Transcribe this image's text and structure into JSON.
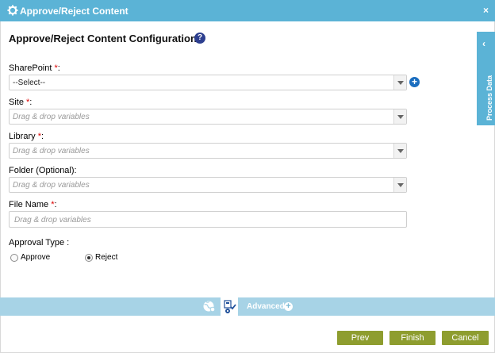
{
  "window": {
    "title": "Approve/Reject Content",
    "close": "×"
  },
  "page": {
    "title": "Approve/Reject Content Configuration",
    "help": "?"
  },
  "fields": {
    "sharepoint": {
      "label": "SharePoint ",
      "req": "*",
      "colon": ":",
      "value": "--Select--"
    },
    "site": {
      "label": "Site ",
      "req": "*",
      "colon": ":",
      "placeholder": "Drag & drop variables"
    },
    "library": {
      "label": "Library ",
      "req": "*",
      "colon": ":",
      "placeholder": "Drag & drop variables"
    },
    "folder": {
      "label": "Folder (Optional):",
      "placeholder": "Drag & drop variables"
    },
    "filename": {
      "label": "File Name ",
      "req": "*",
      "colon": ":",
      "placeholder": "Drag & drop variables"
    }
  },
  "approval": {
    "label": "Approval Type :",
    "options": [
      {
        "label": "Approve",
        "checked": false
      },
      {
        "label": "Reject",
        "checked": true
      }
    ]
  },
  "side_panel": {
    "label": "Process Data",
    "chevron": "‹"
  },
  "bottom_tabs": {
    "advanced_label": "Advanced",
    "plus": "+"
  },
  "buttons": {
    "prev": "Prev",
    "finish": "Finish",
    "cancel": "Cancel"
  },
  "colors": {
    "title_bar": "#5bb3d6",
    "tab_bar": "#a7d3e6",
    "button": "#8e9d2f",
    "required": "#dd0000",
    "help_icon": "#2d3f8f"
  }
}
